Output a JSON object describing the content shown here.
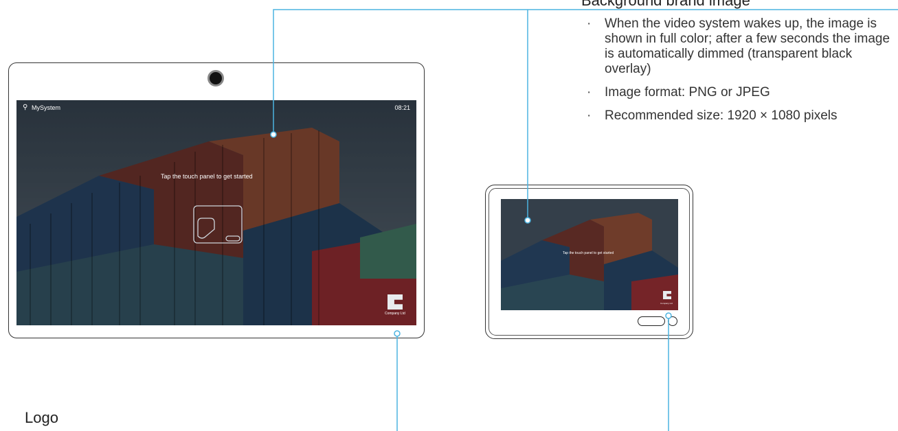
{
  "callout": {
    "title": "Background brand image",
    "bullets": [
      "When the video system wakes up, the image is shown in full color; after a few seconds the image is automatically dimmed (transparent black overlay)",
      "Image format: PNG or JPEG",
      "Recommended size: 1920 × 1080 pixels"
    ]
  },
  "logo_label": "Logo",
  "large_screen": {
    "system_name": "MySystem",
    "clock": "08:21",
    "prompt": "Tap the touch panel to get started",
    "company": "Company Ltd"
  },
  "small_screen": {
    "prompt": "Tap the touch panel to get started",
    "company": "Company Ltd"
  },
  "colors": {
    "callout_line": "#4cb3e0",
    "container_red": "#9a3d36",
    "container_blue": "#2f4f75"
  }
}
